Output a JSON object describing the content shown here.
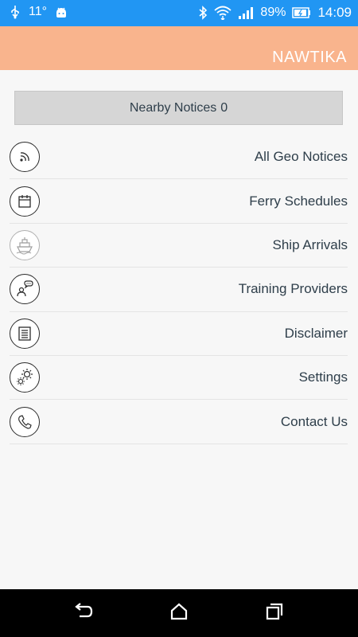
{
  "status_bar": {
    "temperature": "11°",
    "battery_percent": "89%",
    "time": "14:09",
    "icons": [
      "usb-icon",
      "android-icon",
      "bluetooth-icon",
      "wifi-icon",
      "signal-icon",
      "battery-icon"
    ]
  },
  "app_bar": {
    "title": "NAWTIKA",
    "color": "#f9b48d"
  },
  "nearby": {
    "label": "Nearby Notices",
    "count": "0"
  },
  "menu": {
    "items": [
      {
        "label": "All Geo Notices",
        "icon": "rss-icon"
      },
      {
        "label": "Ferry Schedules",
        "icon": "calendar-icon"
      },
      {
        "label": "Ship Arrivals",
        "icon": "ship-icon"
      },
      {
        "label": "Training Providers",
        "icon": "speech-person-icon"
      },
      {
        "label": "Disclaimer",
        "icon": "document-icon"
      },
      {
        "label": "Settings",
        "icon": "gears-icon"
      },
      {
        "label": "Contact Us",
        "icon": "phone-icon"
      }
    ]
  },
  "nav_bar": {
    "icons": [
      "back-icon",
      "home-icon",
      "recents-icon"
    ]
  }
}
